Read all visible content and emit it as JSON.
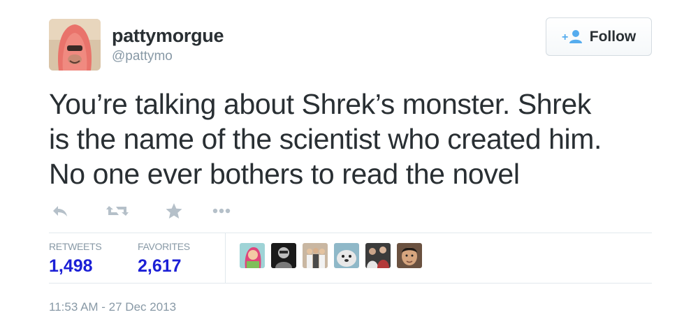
{
  "user": {
    "fullname": "pattymorgue",
    "username": "@pattymo",
    "avatar_icon": "avatar-red-hood"
  },
  "follow": {
    "label": "Follow",
    "icon": "add-user-icon",
    "accent": "#55acee"
  },
  "tweet": {
    "lines": [
      "You’re talking about Shrek’s monster. Shrek",
      "is the name of the scientist who created him.",
      "No one ever bothers to read the novel"
    ]
  },
  "actions": [
    {
      "name": "reply",
      "icon": "reply-icon"
    },
    {
      "name": "retweet",
      "icon": "retweet-icon"
    },
    {
      "name": "favorite",
      "icon": "star-icon"
    },
    {
      "name": "more",
      "icon": "more-icon"
    }
  ],
  "stats": {
    "retweets_label": "RETWEETS",
    "retweets_value": "1,498",
    "favorites_label": "FAVORITES",
    "favorites_value": "2,617",
    "value_color": "#1b1fd6"
  },
  "favorited_by": [
    {
      "icon": "avatar-cartoon-girl"
    },
    {
      "icon": "avatar-bw-portrait"
    },
    {
      "icon": "avatar-group-photo"
    },
    {
      "icon": "avatar-seal"
    },
    {
      "icon": "avatar-crowd"
    },
    {
      "icon": "avatar-man-face"
    }
  ],
  "timestamp": "11:53 AM - 27 Dec 2013"
}
